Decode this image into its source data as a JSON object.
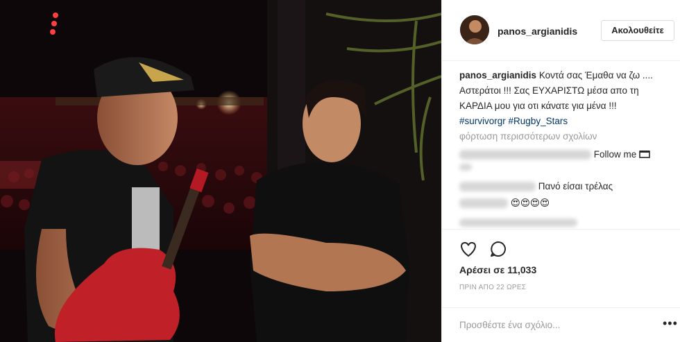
{
  "post": {
    "username": "panos_argianidis",
    "follow_label": "Ακολουθείτε",
    "caption_text": "Κοντά σας Έμαθα να ζω .... Αστεράτοι !!! Σας ΕΥΧΑΡΙΣΤΩ μέσα απο τη ΚΑΡΔΙΑ μου για οτι κάνατε για μένα !!!",
    "hashtag_1": "#survivorgr",
    "hashtag_2": "#Rugby_Stars",
    "load_more": "φόρτωση περισσότερων σχολίων",
    "comments": [
      {
        "text": "Follow me"
      },
      {
        "text": "Πανό είσαι τρέλας"
      },
      {
        "text": "😍😍😍😍"
      }
    ],
    "likes": "Αρέσει σε 11,033",
    "time": "ΠΡΙΝ ΑΠΟ 22 ΩΡΕΣ",
    "add_comment_placeholder": "Προσθέστε ένα σχόλιο...",
    "more_dots": "•••"
  },
  "icons": [
    "heart-icon",
    "comment-icon",
    "more-options-icon",
    "box-icon"
  ],
  "colors": {
    "hashtag": "#003569",
    "text": "#262626",
    "muted": "#999999",
    "border": "#efefef"
  }
}
